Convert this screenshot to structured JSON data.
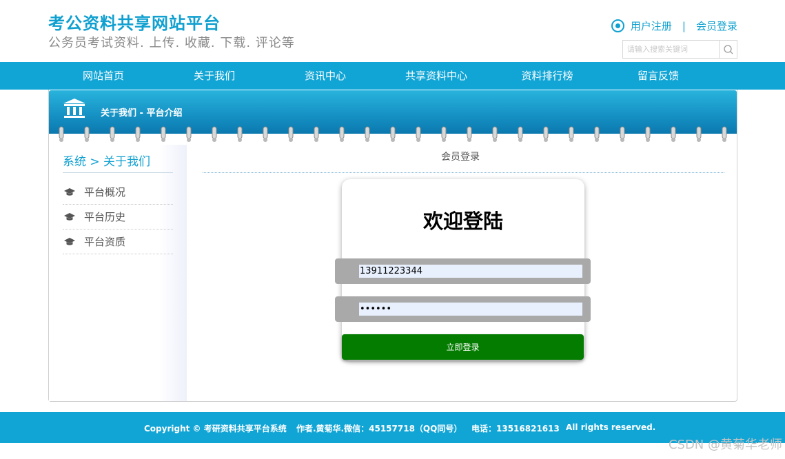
{
  "header": {
    "title": "考公资料共享网站平台",
    "subtitle": "公务员考试资料. 上传. 收藏. 下载. 评论等",
    "register_link": "用户注册",
    "separator": "|",
    "login_link": "会员登录",
    "search_placeholder": "请输入搜索关键词"
  },
  "nav": {
    "items": [
      "网站首页",
      "关于我们",
      "资讯中心",
      "共享资料中心",
      "资料排行榜",
      "留言反馈"
    ]
  },
  "banner": {
    "text": "关于我们 - 平台介绍"
  },
  "sidebar": {
    "title": "系统 > 关于我们",
    "items": [
      "平台概况",
      "平台历史",
      "平台资质"
    ]
  },
  "main": {
    "breadcrumb": "会员登录",
    "login": {
      "title": "欢迎登陆",
      "username_value": "13911223344",
      "password_value": "123456",
      "submit_label": "立即登录"
    }
  },
  "footer": {
    "copyright": "Copyright © 考研资料共享平台系统",
    "author": "作者.黄菊华.微信：45157718（QQ同号）",
    "phone": "电话：13516821613",
    "rights": "All rights reserved."
  },
  "watermark": "CSDN @黄菊华老师",
  "colors": {
    "primary": "#11a5d6",
    "login_button": "#037c00",
    "field_bar": "#a9a9a9"
  }
}
